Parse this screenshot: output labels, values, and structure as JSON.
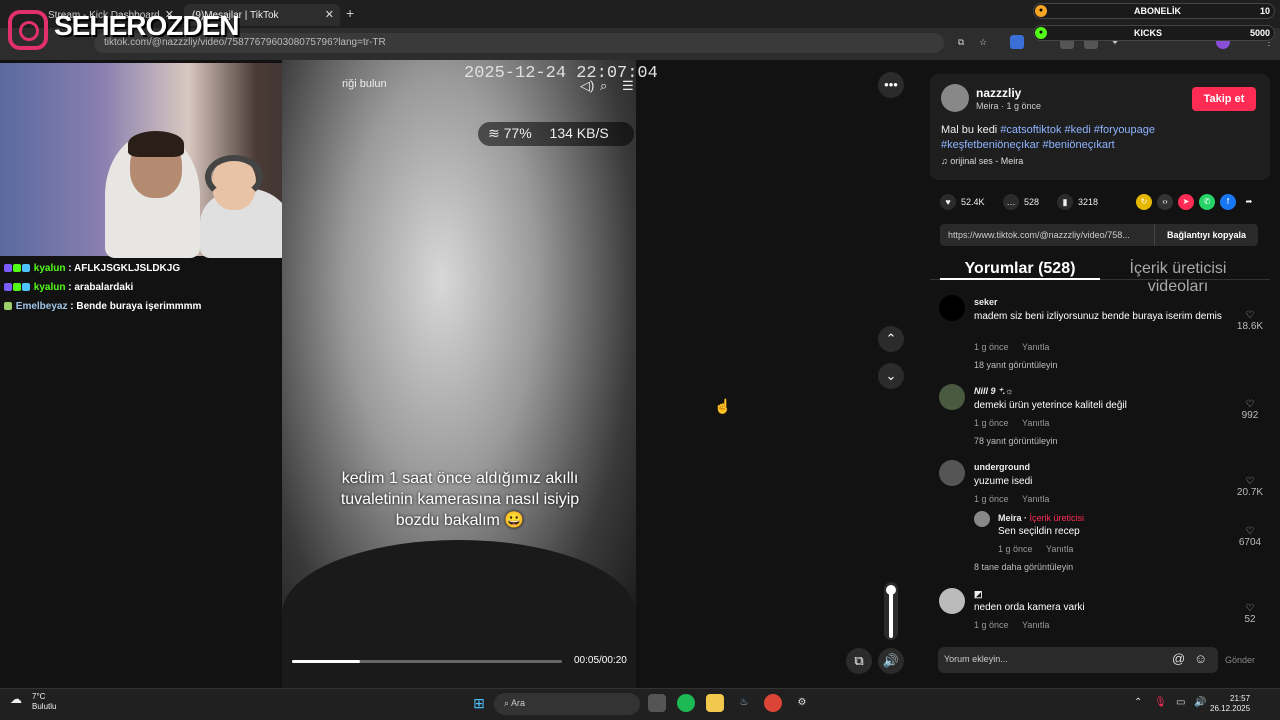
{
  "browser": {
    "tabs": [
      {
        "title": "Stream - Kick Dashboard",
        "active": false
      },
      {
        "title": "(9)Mesajlar | TikTok",
        "active": true
      }
    ],
    "new_tab": "+",
    "url": "tiktok.com/@nazzzliy/video/7587767960308075796?lang=tr-TR"
  },
  "overlay": {
    "brand": "SEHEROZDEN",
    "subscription_label": "ABONELİK",
    "subscription_count": "10",
    "kicks_label": "KICKS",
    "kicks_count": "5000"
  },
  "chat": {
    "messages": [
      {
        "user": "kyalun",
        "text": "AFLKJSGKLJSLDKJG"
      },
      {
        "user": "kyalun",
        "text": "arabalardaki"
      },
      {
        "user": "Emelbeyaz",
        "text": "Bende buraya işerimmmm"
      }
    ]
  },
  "video": {
    "timestamp": "2025-12-24 22:07:04",
    "search_hint": "riği bulun",
    "wifi": "77%",
    "speed": "134 KB/S",
    "caption": "kedim 1 saat önce aldığımız akıllı tuvaletinin kamerasına nasıl isiyip bozdu bakalım 😀",
    "time": "00:05/00:20",
    "progress_fraction": 0.25
  },
  "post": {
    "author": "nazzzliy",
    "subtitle": "Meira · 1 g önce",
    "follow_label": "Takip et",
    "desc_prefix": "Mal bu kedi ",
    "hashtags_line1": "#catsoftiktok #kedi #foryoupage",
    "hashtags_line2": "#keşfetbeniöneçıkar #beniöneçıkart",
    "music": "orijinal ses - Meira",
    "likes": "52.4K",
    "comments": "528",
    "saves": "3218",
    "link": "https://www.tiktok.com/@nazzzliy/video/758...",
    "copy_link": "Bağlantıyı kopyala",
    "tab_comments": "Yorumlar (528)",
    "tab_creator": "İçerik üreticisi videoları"
  },
  "comments": [
    {
      "user": "seker",
      "text": "madem siz beni izliyorsunuz bende buraya iserim demis",
      "time": "1 g önce",
      "reply": "Yanıtla",
      "likes": "18.6K",
      "more": "18 yanıt görüntüleyin"
    },
    {
      "user": "Nill 9 ⁺.☼",
      "text": "demeki ürün yeterince kaliteli değil",
      "time": "1 g önce",
      "reply": "Yanıtla",
      "likes": "992",
      "more": "78 yanıt görüntüleyin"
    },
    {
      "user": "underground",
      "text": "yuzume isedi",
      "time": "1 g önce",
      "reply": "Yanıtla",
      "likes": "20.7K",
      "more": "8 tane daha görüntüleyin"
    },
    {
      "user": "",
      "text": "neden orda kamera varki",
      "time": "1 g önce",
      "reply": "Yanıtla",
      "likes": "52",
      "more": ""
    }
  ],
  "reply": {
    "user": "Meira",
    "creator_tag": "İçerik üreticisi",
    "text": "Sen seçildin recep",
    "time": "1 g önce",
    "reply": "Yanıtla",
    "likes": "6704"
  },
  "comment_input": {
    "placeholder": "Yorum ekleyin...",
    "send": "Gönder"
  },
  "taskbar": {
    "temp": "7°C",
    "weather": "Bulutlu",
    "search": "Ara",
    "time": "21:57",
    "date": "26.12.2025"
  },
  "colors": {
    "accent": "#fe2c55",
    "kick_green": "#53fc18",
    "hashtag": "#8fb4ff"
  }
}
